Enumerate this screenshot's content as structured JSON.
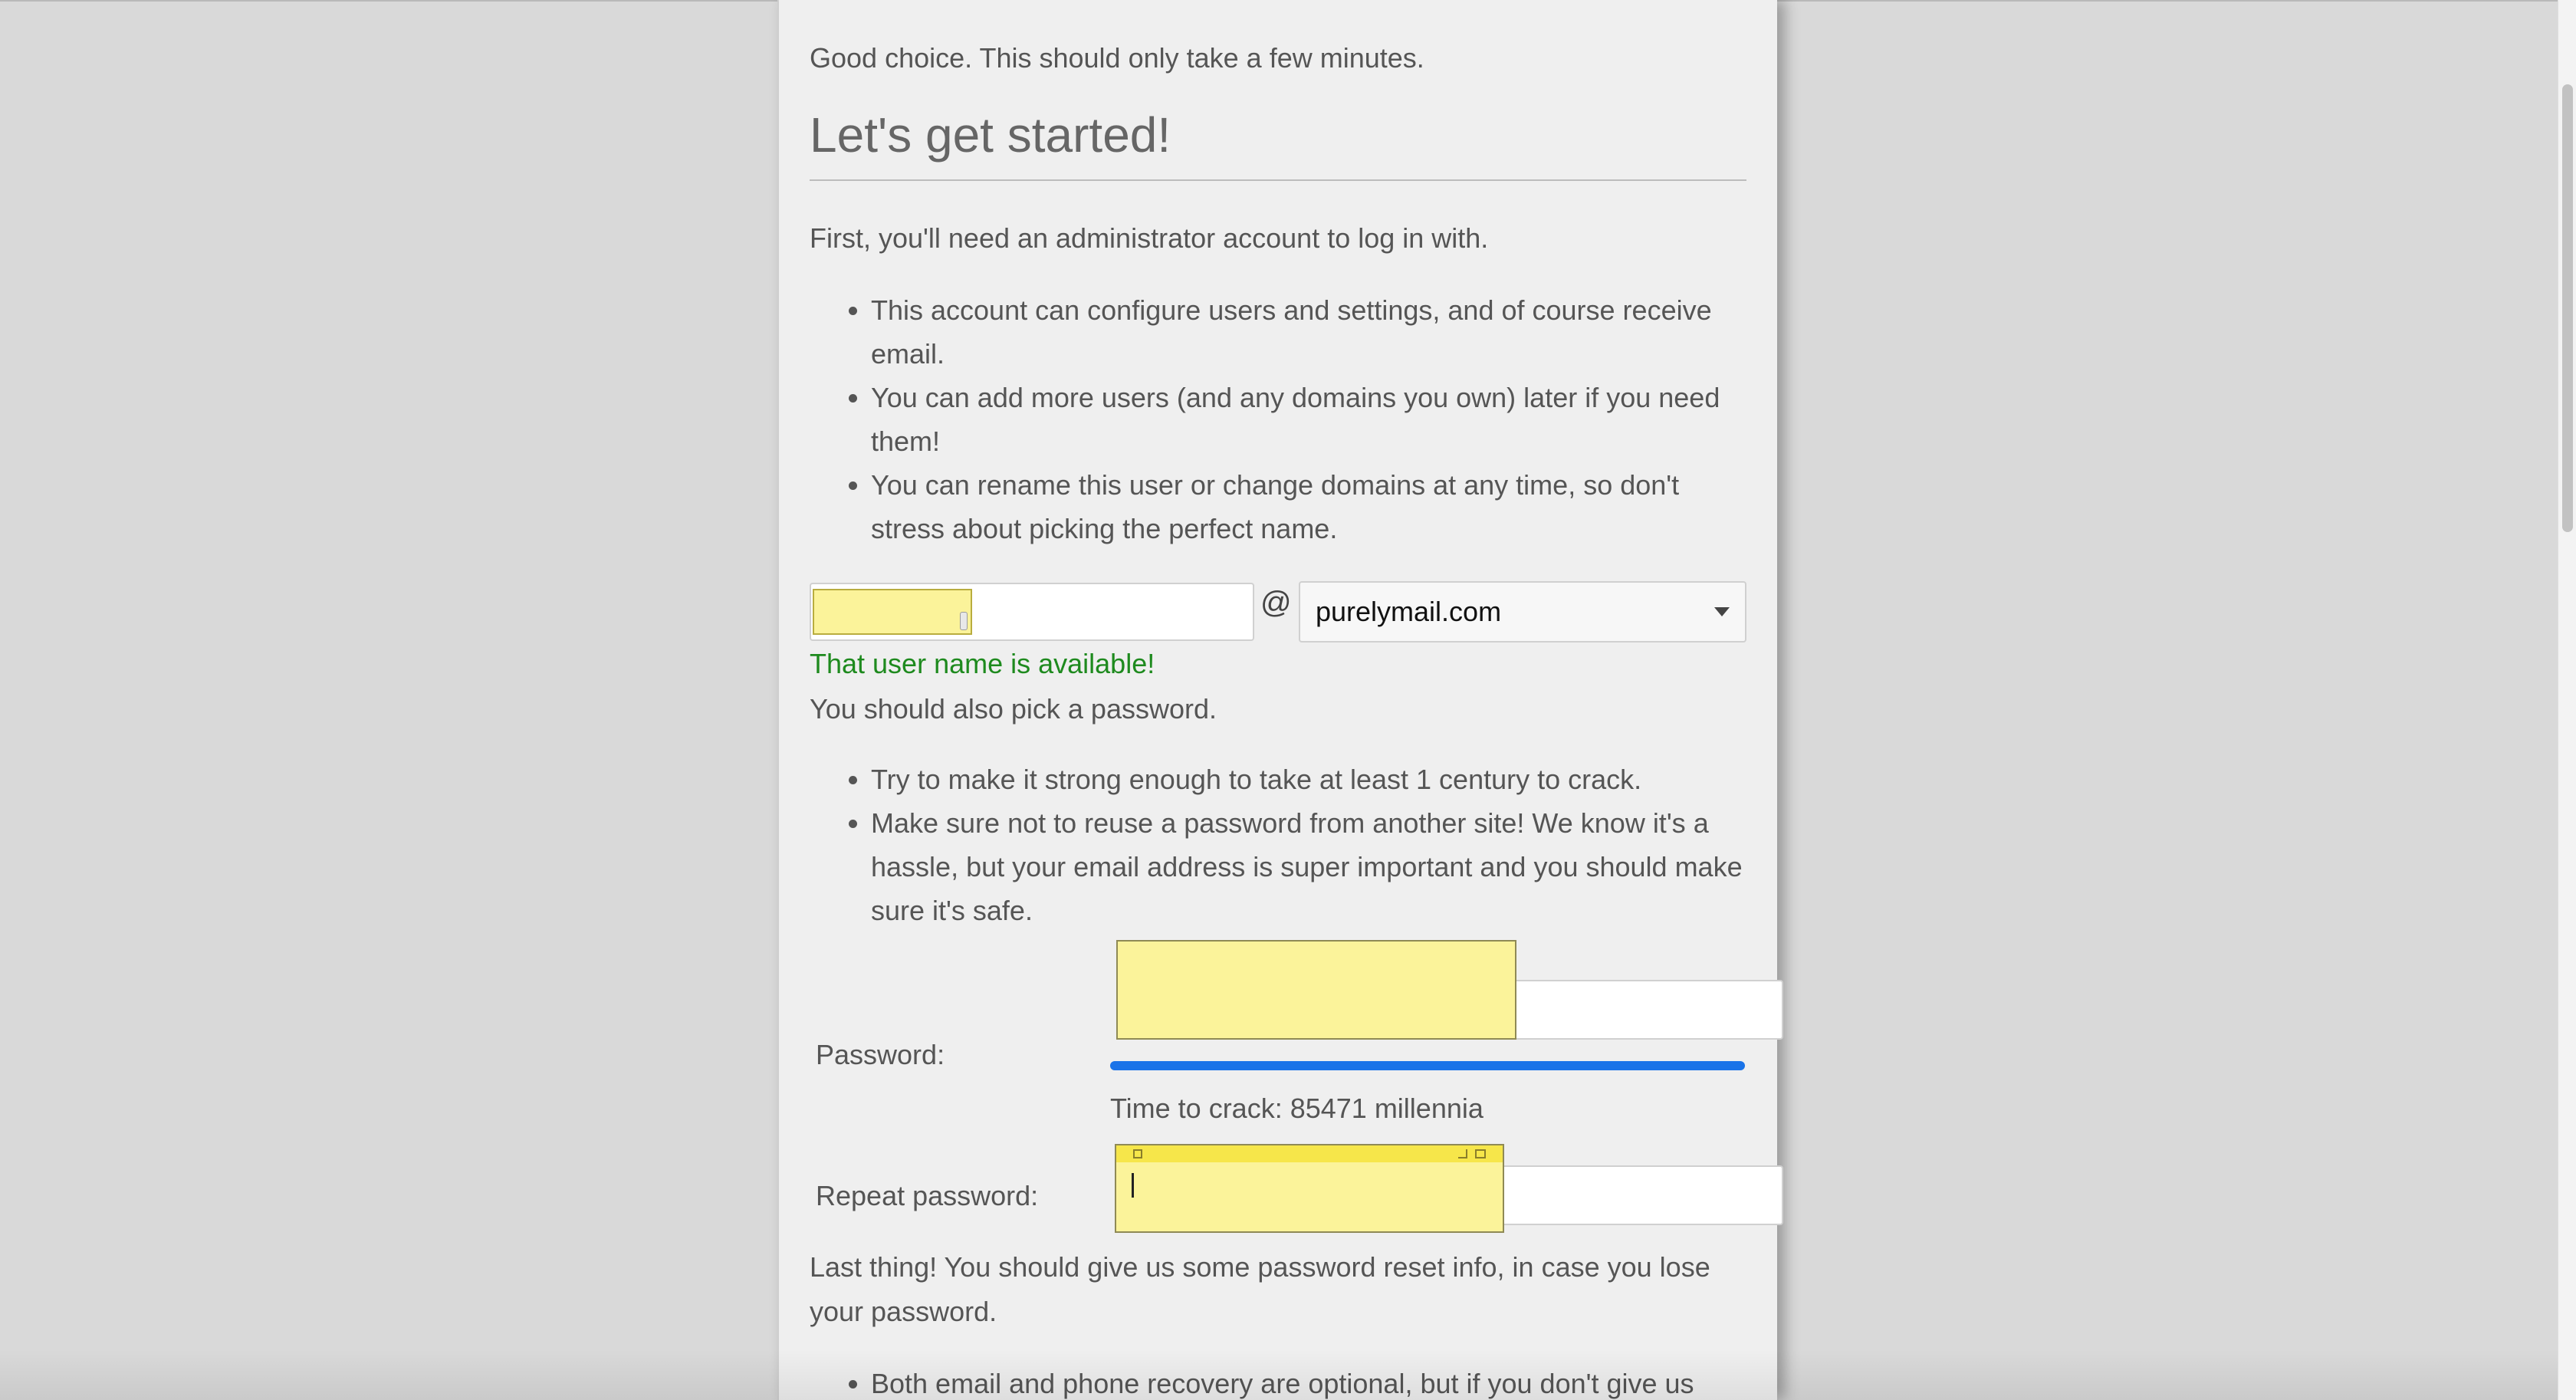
{
  "intro": "Good choice. This should only take a few minutes.",
  "heading": "Let's get started!",
  "account": {
    "text": "First, you'll need an administrator account to log in with.",
    "bullets": [
      "This account can configure users and settings, and of course receive email.",
      "You can add more users (and any domains you own) later if you need them!",
      "You can rename this user or change domains at any time, so don't stress about picking the perfect name."
    ]
  },
  "username": {
    "value": "",
    "at": "@",
    "domain": "purelymail.com",
    "status": "That user name is available!"
  },
  "password_section": {
    "text": "You should also pick a password.",
    "bullets": [
      "Try to make it strong enough to take at least 1 century to crack.",
      "Make sure not to reuse a password from another site! We know it's a hassle, but your email address is super important and you should make sure it's safe."
    ]
  },
  "password": {
    "label": "Password:",
    "strength_fraction": 1.0,
    "crack_time": "Time to crack: 85471 millennia",
    "repeat_label": "Repeat password:",
    "strength_color": "#1a73e8"
  },
  "recovery": {
    "text": "Last thing! You should give us some password reset info, in case you lose your password.",
    "bullets": [
      "Both email and phone recovery are optional, but if you don't give us"
    ]
  },
  "colors": {
    "status_ok": "#1e8a1e",
    "sticky_note": "#fbf39a"
  }
}
